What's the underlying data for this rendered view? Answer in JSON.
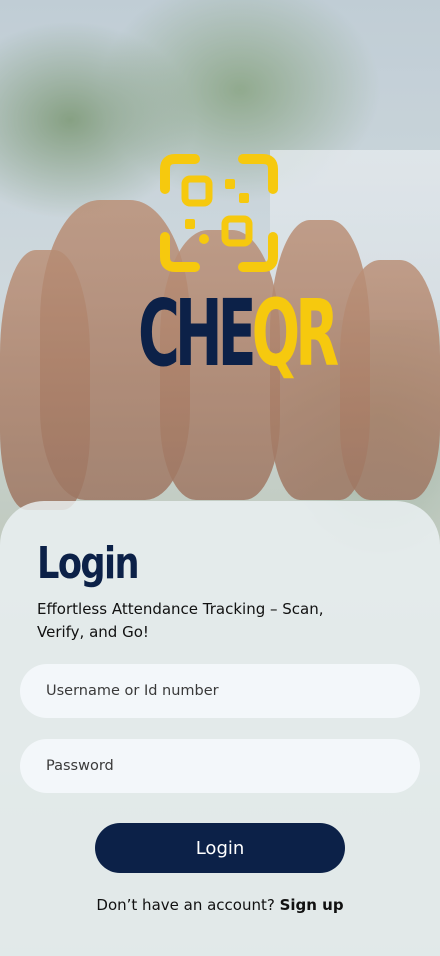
{
  "brand": {
    "wordmark_dark": "CHE",
    "wordmark_accent": "QR",
    "icon": "qr-scan-icon",
    "colors": {
      "navy": "#0c2148",
      "yellow": "#f6c90e"
    }
  },
  "login": {
    "title": "Login",
    "subtitle": "Effortless Attendance Tracking – Scan, Verify, and Go!",
    "username_placeholder": "Username or Id number",
    "password_placeholder": "Password",
    "button_label": "Login"
  },
  "signup": {
    "prompt": "Don’t have an account?",
    "link_label": "Sign up"
  }
}
